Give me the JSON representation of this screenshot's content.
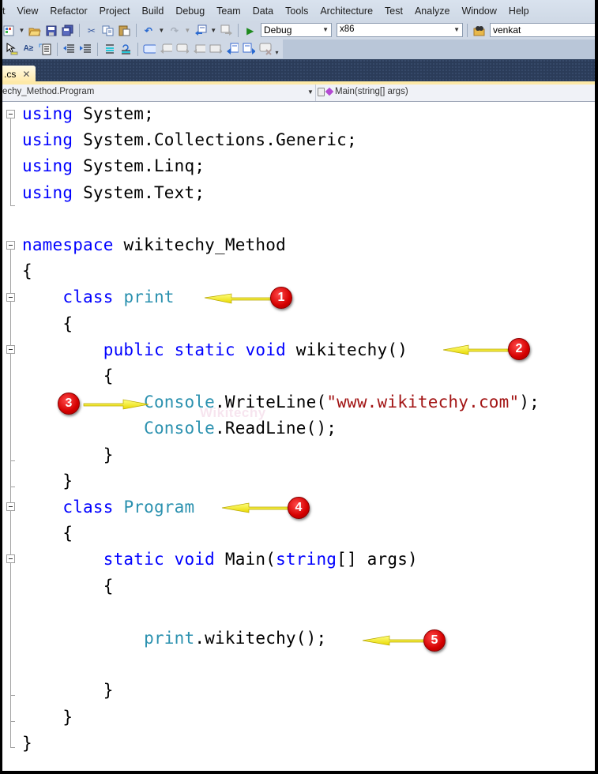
{
  "menu": [
    "t",
    "View",
    "Refactor",
    "Project",
    "Build",
    "Debug",
    "Team",
    "Data",
    "Tools",
    "Architecture",
    "Test",
    "Analyze",
    "Window",
    "Help"
  ],
  "toolbar": {
    "solution_config": "Debug",
    "platform": "x86",
    "find_box": "venkat",
    "icons_row1": [
      "new-project-icon",
      "open-file-icon",
      "save-icon",
      "save-all-icon",
      "cut-icon",
      "copy-icon",
      "paste-icon",
      "undo-icon",
      "redo-icon",
      "navigate-backward-icon",
      "navigate-forward-icon",
      "start-debugging-icon",
      "find-in-files-icon"
    ],
    "icons_row2": [
      "pointer-icon",
      "rename-icon",
      "toggle-outline-icon",
      "decrease-indent-icon",
      "increase-indent-icon",
      "comment-icon",
      "uncomment-icon",
      "bookmark-icon",
      "prev-bookmark-icon",
      "next-bookmark-icon",
      "prev-bookmark-folder-icon",
      "next-bookmark-folder-icon",
      "prev-bookmark-doc-icon",
      "next-bookmark-doc-icon",
      "clear-bookmarks-icon"
    ]
  },
  "document_tab": {
    "label": ".cs",
    "close": "✕"
  },
  "navigation": {
    "type_selector": "echy_Method.Program",
    "member_selector": "Main(string[] args)"
  },
  "code": {
    "lines": [
      [
        [
          "kw",
          "using"
        ],
        [
          "",
          "System;"
        ]
      ],
      [
        [
          "kw",
          "using"
        ],
        [
          "",
          "System.Collections.Generic;"
        ]
      ],
      [
        [
          "kw",
          "using"
        ],
        [
          "",
          "System.Linq;"
        ]
      ],
      [
        [
          "kw",
          "using"
        ],
        [
          "",
          "System.Text;"
        ]
      ],
      [],
      [
        [
          "kw",
          "namespace"
        ],
        [
          "",
          "wikitechy_Method"
        ]
      ],
      [
        [
          "",
          "{"
        ]
      ],
      [
        [
          "",
          "    "
        ],
        [
          "kw",
          "class"
        ],
        [
          "ty",
          "print"
        ]
      ],
      [
        [
          "",
          "    {"
        ]
      ],
      [
        [
          "",
          "        "
        ],
        [
          "kw",
          "public"
        ],
        [
          "kw",
          "static"
        ],
        [
          "kw",
          "void"
        ],
        [
          "",
          "wikitechy()"
        ]
      ],
      [
        [
          "",
          "        {"
        ]
      ],
      [
        [
          "",
          "            "
        ],
        [
          "ty",
          "Console"
        ],
        [
          "",
          ".WriteLine("
        ],
        [
          "str",
          "\"www.wikitechy.com\""
        ],
        [
          "",
          ");"
        ]
      ],
      [
        [
          "",
          "            "
        ],
        [
          "ty",
          "Console"
        ],
        [
          "",
          ".ReadLine();"
        ]
      ],
      [
        [
          "",
          "        }"
        ]
      ],
      [
        [
          "",
          "    }"
        ]
      ],
      [
        [
          "",
          "    "
        ],
        [
          "kw",
          "class"
        ],
        [
          "ty",
          "Program"
        ]
      ],
      [
        [
          "",
          "    {"
        ]
      ],
      [
        [
          "",
          "        "
        ],
        [
          "kw",
          "static"
        ],
        [
          "kw",
          "void"
        ],
        [
          "",
          "Main("
        ],
        [
          "kw",
          "string"
        ],
        [
          "",
          "[] args)"
        ]
      ],
      [
        [
          "",
          "        {"
        ]
      ],
      [],
      [
        [
          "",
          "            "
        ],
        [
          "ty",
          "print"
        ],
        [
          "",
          ".wikitechy();"
        ]
      ],
      [],
      [
        [
          "",
          "        }"
        ]
      ],
      [
        [
          "",
          "    }"
        ]
      ],
      [
        [
          "",
          "}"
        ]
      ]
    ]
  },
  "annotations": [
    {
      "number": "1",
      "target": "class print"
    },
    {
      "number": "2",
      "target": "wikitechy()"
    },
    {
      "number": "3",
      "target": "Console.WriteLine"
    },
    {
      "number": "4",
      "target": "class Program"
    },
    {
      "number": "5",
      "target": "print.wikitechy();"
    }
  ],
  "watermark": "Wikitechy",
  "colors": {
    "keyword": "#0000ff",
    "type": "#2b91af",
    "string": "#a31515",
    "arrow": "#ffff00",
    "badge": "#d40000"
  }
}
